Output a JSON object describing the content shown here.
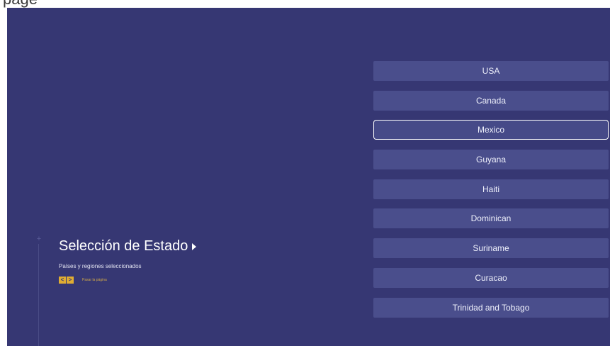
{
  "page_header": "page",
  "panel": {
    "title": "Selección de Estado",
    "subtitle": "Países y regiones seleccionados",
    "hint_keys": [
      "<",
      ">"
    ],
    "hint_text": "Pasar la página"
  },
  "countries": [
    {
      "label": "USA",
      "selected": false
    },
    {
      "label": "Canada",
      "selected": false
    },
    {
      "label": "Mexico",
      "selected": true
    },
    {
      "label": "Guyana",
      "selected": false
    },
    {
      "label": "Haiti",
      "selected": false
    },
    {
      "label": "Dominican",
      "selected": false
    },
    {
      "label": "Suriname",
      "selected": false
    },
    {
      "label": "Curacao",
      "selected": false
    },
    {
      "label": "Trinidad and Tobago",
      "selected": false
    }
  ],
  "colors": {
    "background": "#363773",
    "button": "#4a4e8c",
    "accent": "#e0ad32",
    "text": "#ffffff"
  },
  "icons": {
    "title_arrow": "caret-right-icon",
    "timeline_marker": "plus-icon"
  }
}
